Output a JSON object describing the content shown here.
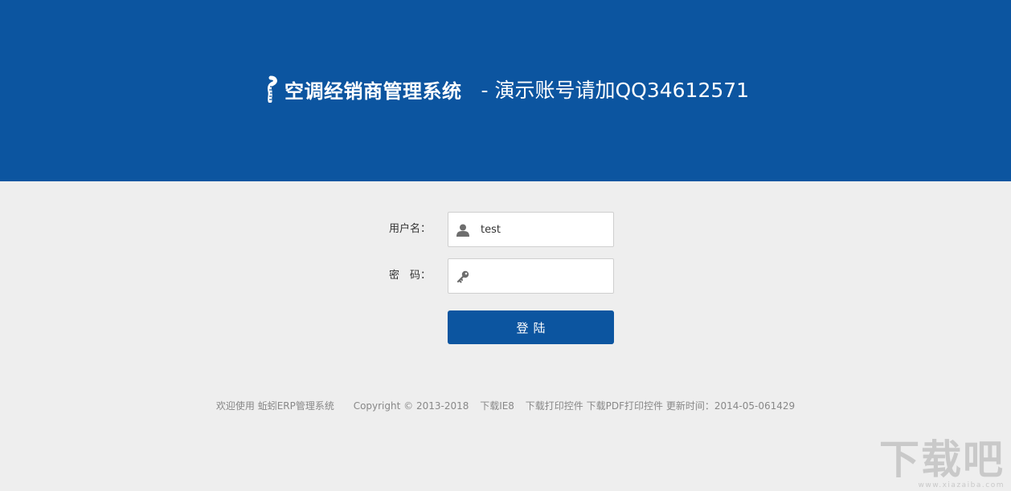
{
  "header": {
    "title": "空调经销商管理系统",
    "subtitle": "- 演示账号请加QQ34612571"
  },
  "form": {
    "username_label": "用户名：",
    "username_value": "test",
    "password_label": "密　码：",
    "password_value": "",
    "login_label": "登陆"
  },
  "footer": {
    "welcome": "欢迎使用 蚯蚓ERP管理系统",
    "copyright": "Copyright © 2013-2018",
    "download_ie8": "下载IE8",
    "download_print": "下载打印控件",
    "download_pdf": "下载PDF打印控件",
    "update_time": "更新时间：2014-05-061429"
  },
  "watermark": {
    "text": "下载吧",
    "url": "www.xiazaiba.com"
  },
  "colors": {
    "primary": "#0c55a0",
    "background": "#eeeeee",
    "footer_text": "#888888"
  },
  "icons": {
    "logo": "worm-logo-icon",
    "username": "user-icon",
    "password": "key-icon"
  }
}
